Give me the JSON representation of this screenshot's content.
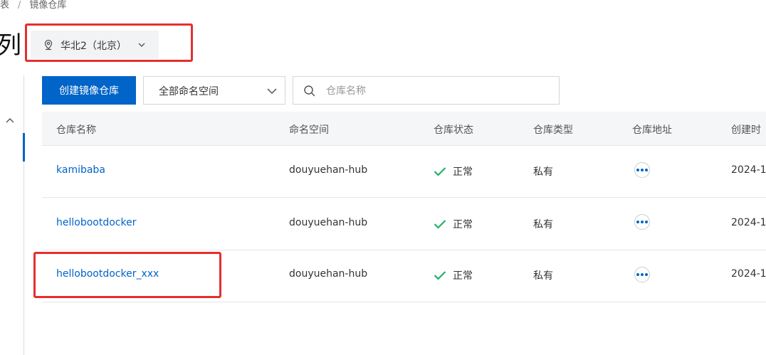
{
  "breadcrumb": {
    "parent": "表",
    "separator": "/",
    "current": "镜像仓库"
  },
  "page_title": "列",
  "region": {
    "label": "华北2（北京）",
    "icon": "location-pin-icon"
  },
  "toolbar": {
    "create_button": "创建镜像仓库",
    "namespace_select": "全部命名空间",
    "search_placeholder": "仓库名称"
  },
  "table": {
    "headers": {
      "name": "仓库名称",
      "namespace": "命名空间",
      "status": "仓库状态",
      "type": "仓库类型",
      "address": "仓库地址",
      "created": "创建时"
    },
    "rows": [
      {
        "name": "kamibaba",
        "namespace": "douyuehan-hub",
        "status": "正常",
        "type": "私有",
        "created": "2024-1"
      },
      {
        "name": "hellobootdocker",
        "namespace": "douyuehan-hub",
        "status": "正常",
        "type": "私有",
        "created": "2024-1"
      },
      {
        "name": "hellobootdocker_xxx",
        "namespace": "douyuehan-hub",
        "status": "正常",
        "type": "私有",
        "created": "2024-1"
      }
    ]
  },
  "colors": {
    "primary": "#0064c8",
    "success": "#23b066",
    "highlight": "#e62e2e"
  }
}
